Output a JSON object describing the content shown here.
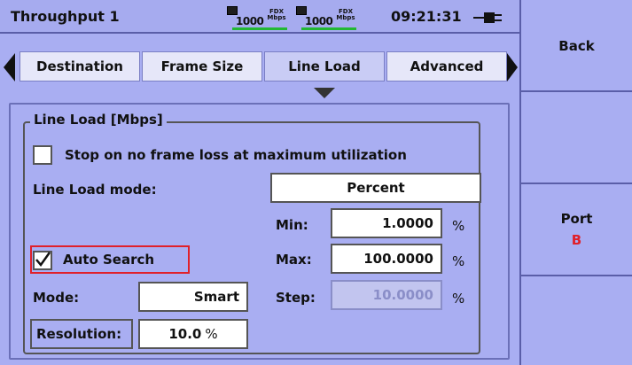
{
  "header": {
    "title": "Throughput 1",
    "port1": {
      "speed": "1000",
      "duplex": "FDX",
      "unit": "Mbps"
    },
    "port2": {
      "speed": "1000",
      "duplex": "FDX",
      "unit": "Mbps"
    },
    "clock": "09:21:31"
  },
  "tabs": [
    "Destination",
    "Frame Size",
    "Line Load",
    "Advanced"
  ],
  "active_tab": "Line Load",
  "sidebar": {
    "back_label": "Back",
    "port_label": "Port",
    "port_value": "B"
  },
  "group": {
    "title": "Line Load [Mbps]",
    "stop_checkbox_label": "Stop on no frame loss at maximum utilization",
    "stop_checked": false,
    "line_load_mode_label": "Line Load mode:",
    "line_load_mode_value": "Percent",
    "min_label": "Min:",
    "min_value": "1.0000",
    "max_label": "Max:",
    "max_value": "100.0000",
    "step_label": "Step:",
    "step_value": "10.0000",
    "percent_unit": "%",
    "auto_search_label": "Auto Search",
    "auto_search_checked": true,
    "mode_label": "Mode:",
    "mode_value": "Smart",
    "resolution_label": "Resolution:",
    "resolution_value": "10.0",
    "resolution_unit": "%"
  },
  "colors": {
    "background": "#a9aef2",
    "accent_red": "#e0202a",
    "link_green": "#22b833"
  }
}
